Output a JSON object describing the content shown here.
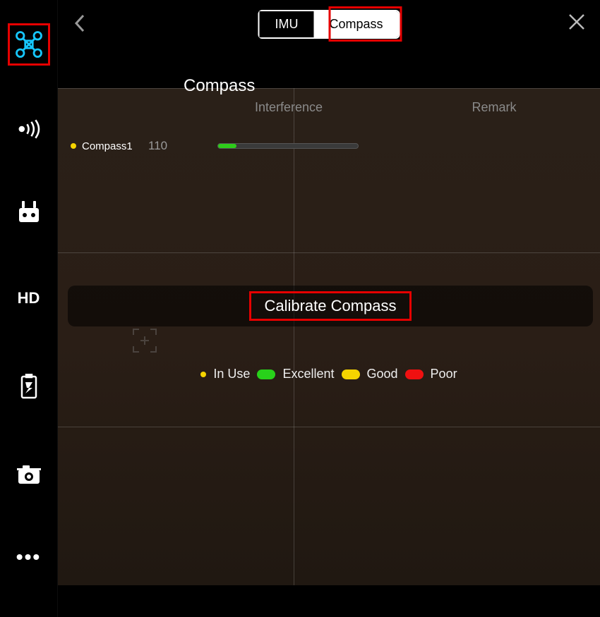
{
  "topbar": {
    "tabs": {
      "imu": "IMU",
      "compass": "Compass"
    },
    "active_tab": "compass"
  },
  "sidebar": {
    "hd_label": "HD"
  },
  "section": {
    "title": "Compass",
    "columns": {
      "interference": "Interference",
      "remark": "Remark"
    },
    "rows": [
      {
        "name": "Compass1",
        "value": "110",
        "level_percent": 13
      }
    ]
  },
  "calibrate": {
    "label": "Calibrate Compass"
  },
  "legend": {
    "in_use": "In Use",
    "excellent": "Excellent",
    "good": "Good",
    "poor": "Poor"
  },
  "colors": {
    "excellent": "#28d11a",
    "good": "#f5d400",
    "poor": "#f01010",
    "accent": "#16c7ff"
  }
}
